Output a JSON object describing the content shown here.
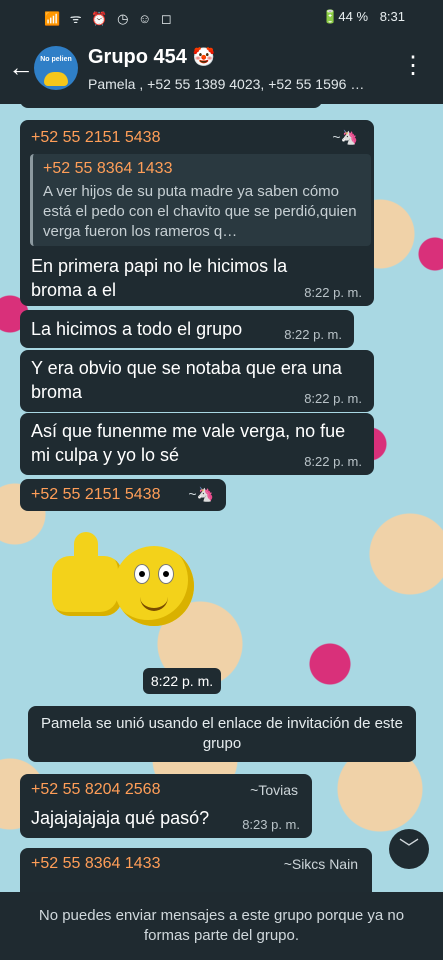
{
  "statusbar": {
    "left_icons": "📶 ᯤ ⏰ ◷ ☺ ◻",
    "battery": "🔋44 %",
    "time": "8:31"
  },
  "header": {
    "back_icon": "arrow-left-icon",
    "avatar_text": "No pelien",
    "title": "Grupo 454",
    "title_emoji": "🤡",
    "subtitle": "Pamela , +52 55 1389 4023, +52 55 1596 …",
    "menu_icon": "⋮"
  },
  "messages": {
    "m1": {
      "sender": "+52 55 2151 5438",
      "tag": "~🦄",
      "quote_sender": "+52 55 8364 1433",
      "quote_text": "A ver hijos de su puta madre ya saben cómo está el pedo con el chavito que se perdió,quien verga fueron los rameros q…",
      "text": "En primera papi no le hicimos la broma a el",
      "time": "8:22 p. m."
    },
    "m2": {
      "text": "La hicimos a todo el grupo",
      "time": "8:22 p. m."
    },
    "m3": {
      "text": "Y era obvio que se notaba que era una broma",
      "time": "8:22 p. m."
    },
    "m4": {
      "text": "Así que funenme me vale verga, no fue mi culpa y yo lo sé",
      "time": "8:22 p. m."
    },
    "m5": {
      "sender": "+52 55 2151 5438",
      "tag": "~🦄"
    },
    "sticker_time": "8:22 p. m.",
    "system": "Pamela se unió usando el enlace de invitación de este grupo",
    "m6": {
      "sender": "+52 55 8204 2568",
      "tag": "~Tovias",
      "text": "Jajajajajaja qué pasó?",
      "time": "8:23 p. m."
    },
    "m7": {
      "sender": "+52 55 8364 1433",
      "tag": "~Sikcs Nain"
    }
  },
  "scroll_down_icon": "﹀",
  "footer": "No puedes enviar mensajes a este grupo porque ya no formas parte del grupo."
}
